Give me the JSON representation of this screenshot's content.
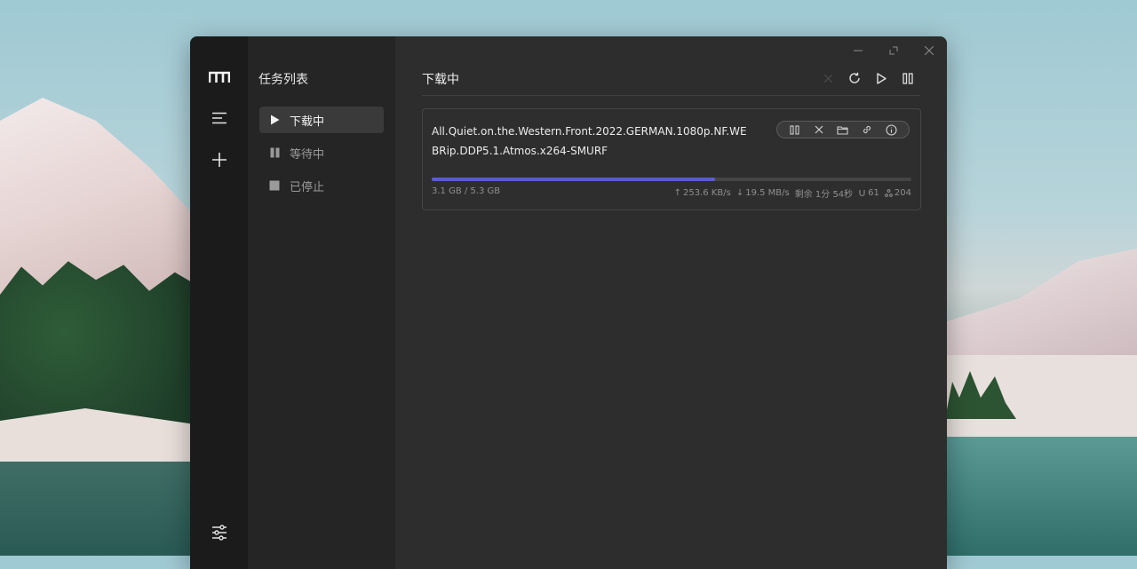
{
  "app": {
    "sidebar_title": "任务列表",
    "nav": [
      {
        "label": "下载中",
        "icon": "play-icon",
        "active": true
      },
      {
        "label": "等待中",
        "icon": "pause-icon",
        "active": false
      },
      {
        "label": "已停止",
        "icon": "stop-icon",
        "active": false
      }
    ]
  },
  "main": {
    "title": "下载中",
    "toolbar": [
      "close-icon",
      "refresh-icon",
      "play-icon",
      "pause-icon"
    ]
  },
  "task": {
    "name": "All.Quiet.on.the.Western.Front.2022.GERMAN.1080p.NF.WEBRip.DDP5.1.Atmos.x264-SMURF",
    "progress": 0.59,
    "size": "3.1 GB / 5.3 GB",
    "upload_speed": "253.6 KB/s",
    "download_speed": "19.5 MB/s",
    "remaining": "剩余 1分 54秒",
    "connections": "61",
    "peers": "204",
    "actions": [
      "pause-icon",
      "close-icon",
      "folder-icon",
      "link-icon",
      "info-icon"
    ]
  },
  "colors": {
    "accent": "#5b5bd6",
    "rail": "#1b1b1b",
    "sidebar": "#252525",
    "main": "#2d2d2d"
  }
}
